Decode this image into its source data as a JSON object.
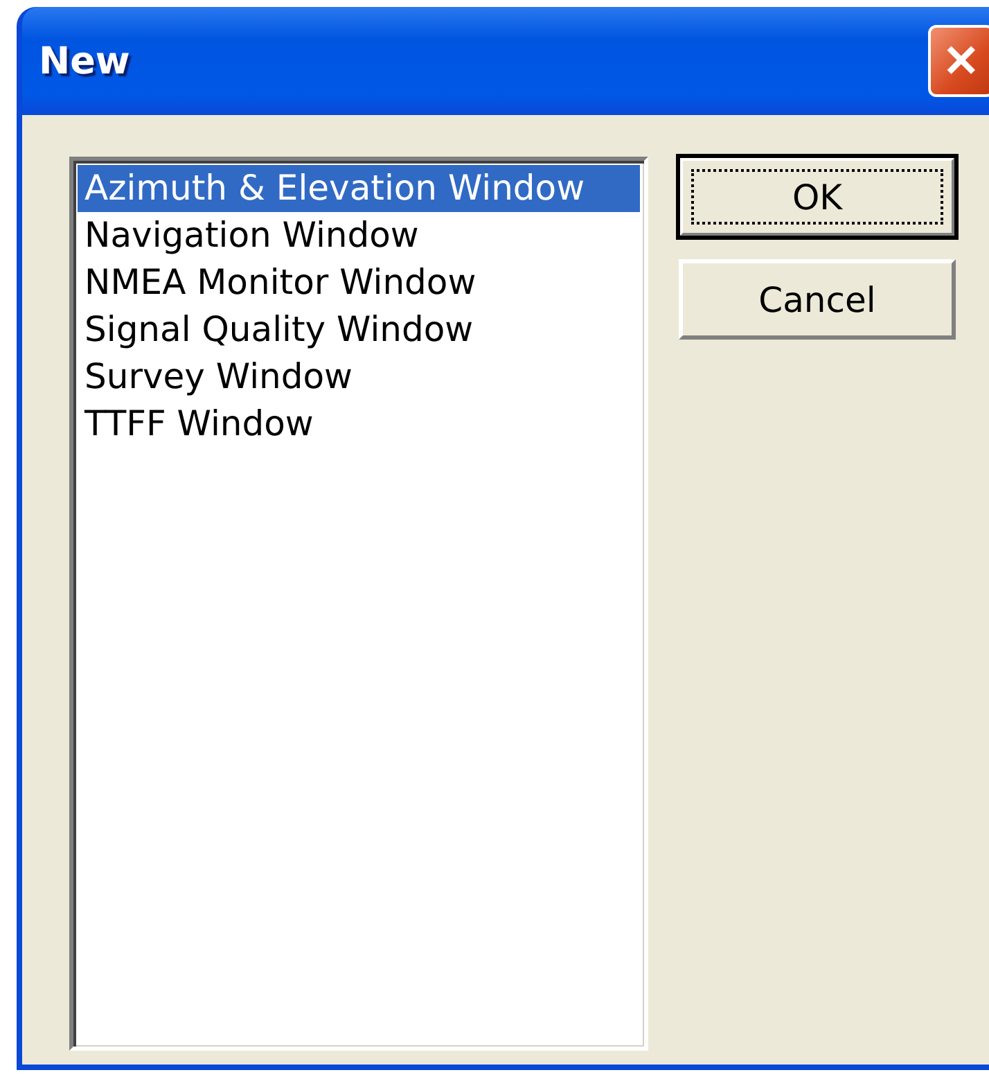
{
  "window": {
    "title": "New",
    "close": "✕"
  },
  "list": {
    "items": [
      {
        "label": "Azimuth & Elevation Window",
        "selected": true
      },
      {
        "label": "Navigation Window",
        "selected": false
      },
      {
        "label": "NMEA Monitor Window",
        "selected": false
      },
      {
        "label": "Signal Quality Window",
        "selected": false
      },
      {
        "label": "Survey Window",
        "selected": false
      },
      {
        "label": "TTFF Window",
        "selected": false
      }
    ]
  },
  "buttons": [
    {
      "label": "OK",
      "focused": true
    },
    {
      "label": "Cancel",
      "focused": false
    }
  ]
}
